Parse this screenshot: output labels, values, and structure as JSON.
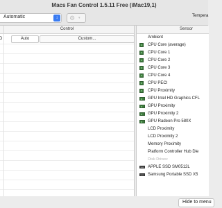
{
  "window": {
    "title": "Macs Fan Control 1.5.11 Free (iMac19,1)"
  },
  "toolbar": {
    "preset_value": "Automatic",
    "temperature_label": "Tempera"
  },
  "fans": {
    "header_label": "Control",
    "rows": [
      {
        "row_prefix": "D",
        "auto_label": "Auto",
        "custom_label": "Custom..."
      }
    ],
    "empty_row_count": 16
  },
  "sensors": {
    "header_label": "Sensor",
    "items": [
      {
        "name": "Ambient",
        "icon": "none"
      },
      {
        "name": "CPU Core (average)",
        "icon": "chip"
      },
      {
        "name": "CPU Core 1",
        "icon": "chip"
      },
      {
        "name": "CPU Core 2",
        "icon": "chip"
      },
      {
        "name": "CPU Core 3",
        "icon": "chip"
      },
      {
        "name": "CPU Core 4",
        "icon": "chip"
      },
      {
        "name": "CPU PECI",
        "icon": "chip"
      },
      {
        "name": "CPU Proximity",
        "icon": "chip"
      },
      {
        "name": "GPU Intel HD Graphics CFL",
        "icon": "gpu"
      },
      {
        "name": "GPU Proximity",
        "icon": "gpu"
      },
      {
        "name": "GPU Proximity 2",
        "icon": "gpu"
      },
      {
        "name": "GPU Radeon Pro 580X",
        "icon": "gpu"
      },
      {
        "name": "LCD Proximity",
        "icon": "none"
      },
      {
        "name": "LCD Proximity 2",
        "icon": "none"
      },
      {
        "name": "Memory Proximity",
        "icon": "none"
      },
      {
        "name": "Platform Controller Hub Die",
        "icon": "none"
      },
      {
        "name": "Disk Drives:",
        "icon": "group"
      },
      {
        "name": "APPLE SSD SM0512L",
        "icon": "disk"
      },
      {
        "name": "Samsung Portable SSD X5",
        "icon": "disk"
      }
    ]
  },
  "bottom": {
    "hide_label": "Hide to menu"
  },
  "colors": {
    "accent": "#3a7cf2",
    "sensor_chip": "#3f7a3f",
    "panel_bg": "#ffffff",
    "window_bg": "#ececec"
  }
}
